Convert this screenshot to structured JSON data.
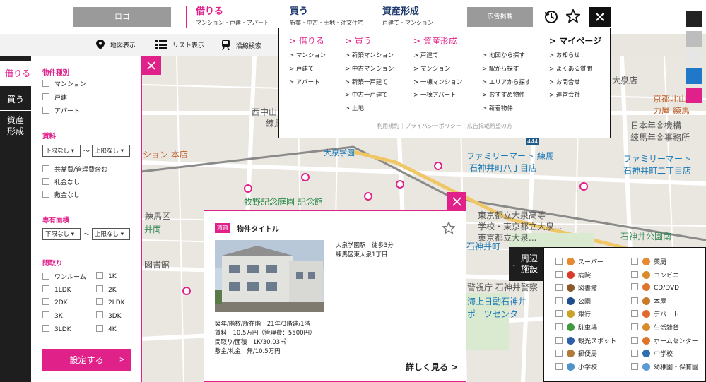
{
  "header": {
    "logo": "ロゴ",
    "nav": [
      {
        "title": "借りる",
        "sub": "マンション・戸建・アパート"
      },
      {
        "title": "買う",
        "sub": "新築・中古・土地・注文住宅"
      },
      {
        "title": "資産形成",
        "sub": "戸建て・マンション"
      }
    ],
    "ad": "広告掲載"
  },
  "subbar": {
    "map": "地図表示",
    "list": "リスト表示",
    "line": "沿線検索"
  },
  "mega": {
    "rent": {
      "title": "> 借りる",
      "items": [
        "> マンション",
        "> 戸建て",
        "> アパート"
      ]
    },
    "buy": {
      "title": "> 買う",
      "items": [
        "> 新築マンション",
        "> 中古マンション",
        "> 新築一戸建て",
        "> 中古一戸建て",
        "> 土地"
      ]
    },
    "asset": {
      "title": "> 資産形成",
      "items": [
        "> 戸建て",
        "> マンション",
        "> 一棟マンション",
        "> 一棟アパート"
      ]
    },
    "search": {
      "items": [
        "> 地図から探す",
        "> 駅から探す",
        "> エリアから探す",
        "> おすすめ物件",
        "> 新着物件"
      ]
    },
    "mypage": {
      "title": "> マイページ",
      "items": [
        "> お知らせ",
        "> よくある質問",
        "> お問合せ",
        "> 運営会社"
      ]
    },
    "footer": "利用規約｜プライバシーポリシー｜広告掲載希望の方"
  },
  "tabs": {
    "rent": "借りる",
    "buy": "買う",
    "asset1": "資産",
    "asset2": "形成"
  },
  "filter": {
    "type_title": "物件種別",
    "types": [
      "マンション",
      "戸建",
      "アパート"
    ],
    "rent_title": "賃料",
    "min": "下限なし ▾",
    "max": "上限なし ▾",
    "tilde": "〜",
    "rent_opts": [
      "共益費/管理費含む",
      "礼金なし",
      "敷金なし"
    ],
    "area_title": "専有面積",
    "layout_title": "間取り",
    "layouts_left": [
      "ワンルーム",
      "1LDK",
      "2DK",
      "3K",
      "3LDK"
    ],
    "layouts_right": [
      "1K",
      "2K",
      "2LDK",
      "3DK",
      "4K"
    ],
    "submit": "設定する",
    "submit_arrow": ">"
  },
  "card": {
    "badge": "賃貸",
    "title": "物件タイトル",
    "station": "大泉学園駅　徒歩3分",
    "address": "練馬区東大泉1丁目",
    "info": [
      "築年/階数/所在階　21年/3階建/1階",
      "賃料　10.5万円（管理費：5500円）",
      "間取り/面積　1K/30.03㎡",
      "敷金/礼金　無/10.5万円"
    ],
    "more": "詳しく見る >"
  },
  "facilities": {
    "tab1": "周辺",
    "tab2": "施設",
    "left": [
      "スーパー",
      "病院",
      "図書館",
      "公園",
      "銀行",
      "駐車場",
      "観光スポット",
      "郵便局",
      "小学校"
    ],
    "right": [
      "薬局",
      "コンビニ",
      "CD/DVD",
      "本屋",
      "デパート",
      "生活雑貨",
      "ホームセンター",
      "中学校",
      "幼稚園・保育園"
    ],
    "left_colors": [
      "#e8892f",
      "#d93a2b",
      "#8a5a2b",
      "#1f4e8c",
      "#c9a227",
      "#3f9a3f",
      "#2b5fa8",
      "#b07b3a",
      "#4f93c9"
    ],
    "right_colors": [
      "#e8892f",
      "#d98a2b",
      "#e0742b",
      "#c97a2b",
      "#e06a2b",
      "#d98a2b",
      "#e0742b",
      "#2b6fb0",
      "#5b9bd5"
    ]
  },
  "map_labels": [
    "大泉学園",
    "練馬区",
    "牧野記念庭園 記念館",
    "ファミリーマート 練馬",
    "石神井町八丁目店",
    "ファミリーマート",
    "石神井町二丁目店",
    "日本年金機構",
    "練馬年金事務所",
    "京都北山",
    "力屋 練馬",
    "東京都立大泉高等",
    "学校・東京都立大泉...",
    "大泉店",
    "ション 本店",
    "西中山 妙福",
    "図書館",
    "警視庁 石神井警察",
    "海上日動石神井",
    "ポーツセンター",
    "石神井公園南",
    "石神井町",
    "東京都立大泉...",
    "井両",
    "練馬",
    "444"
  ],
  "colors": {
    "accent": "#e0218a",
    "navy": "#1f3a6e",
    "dark": "#1e1e1e"
  }
}
